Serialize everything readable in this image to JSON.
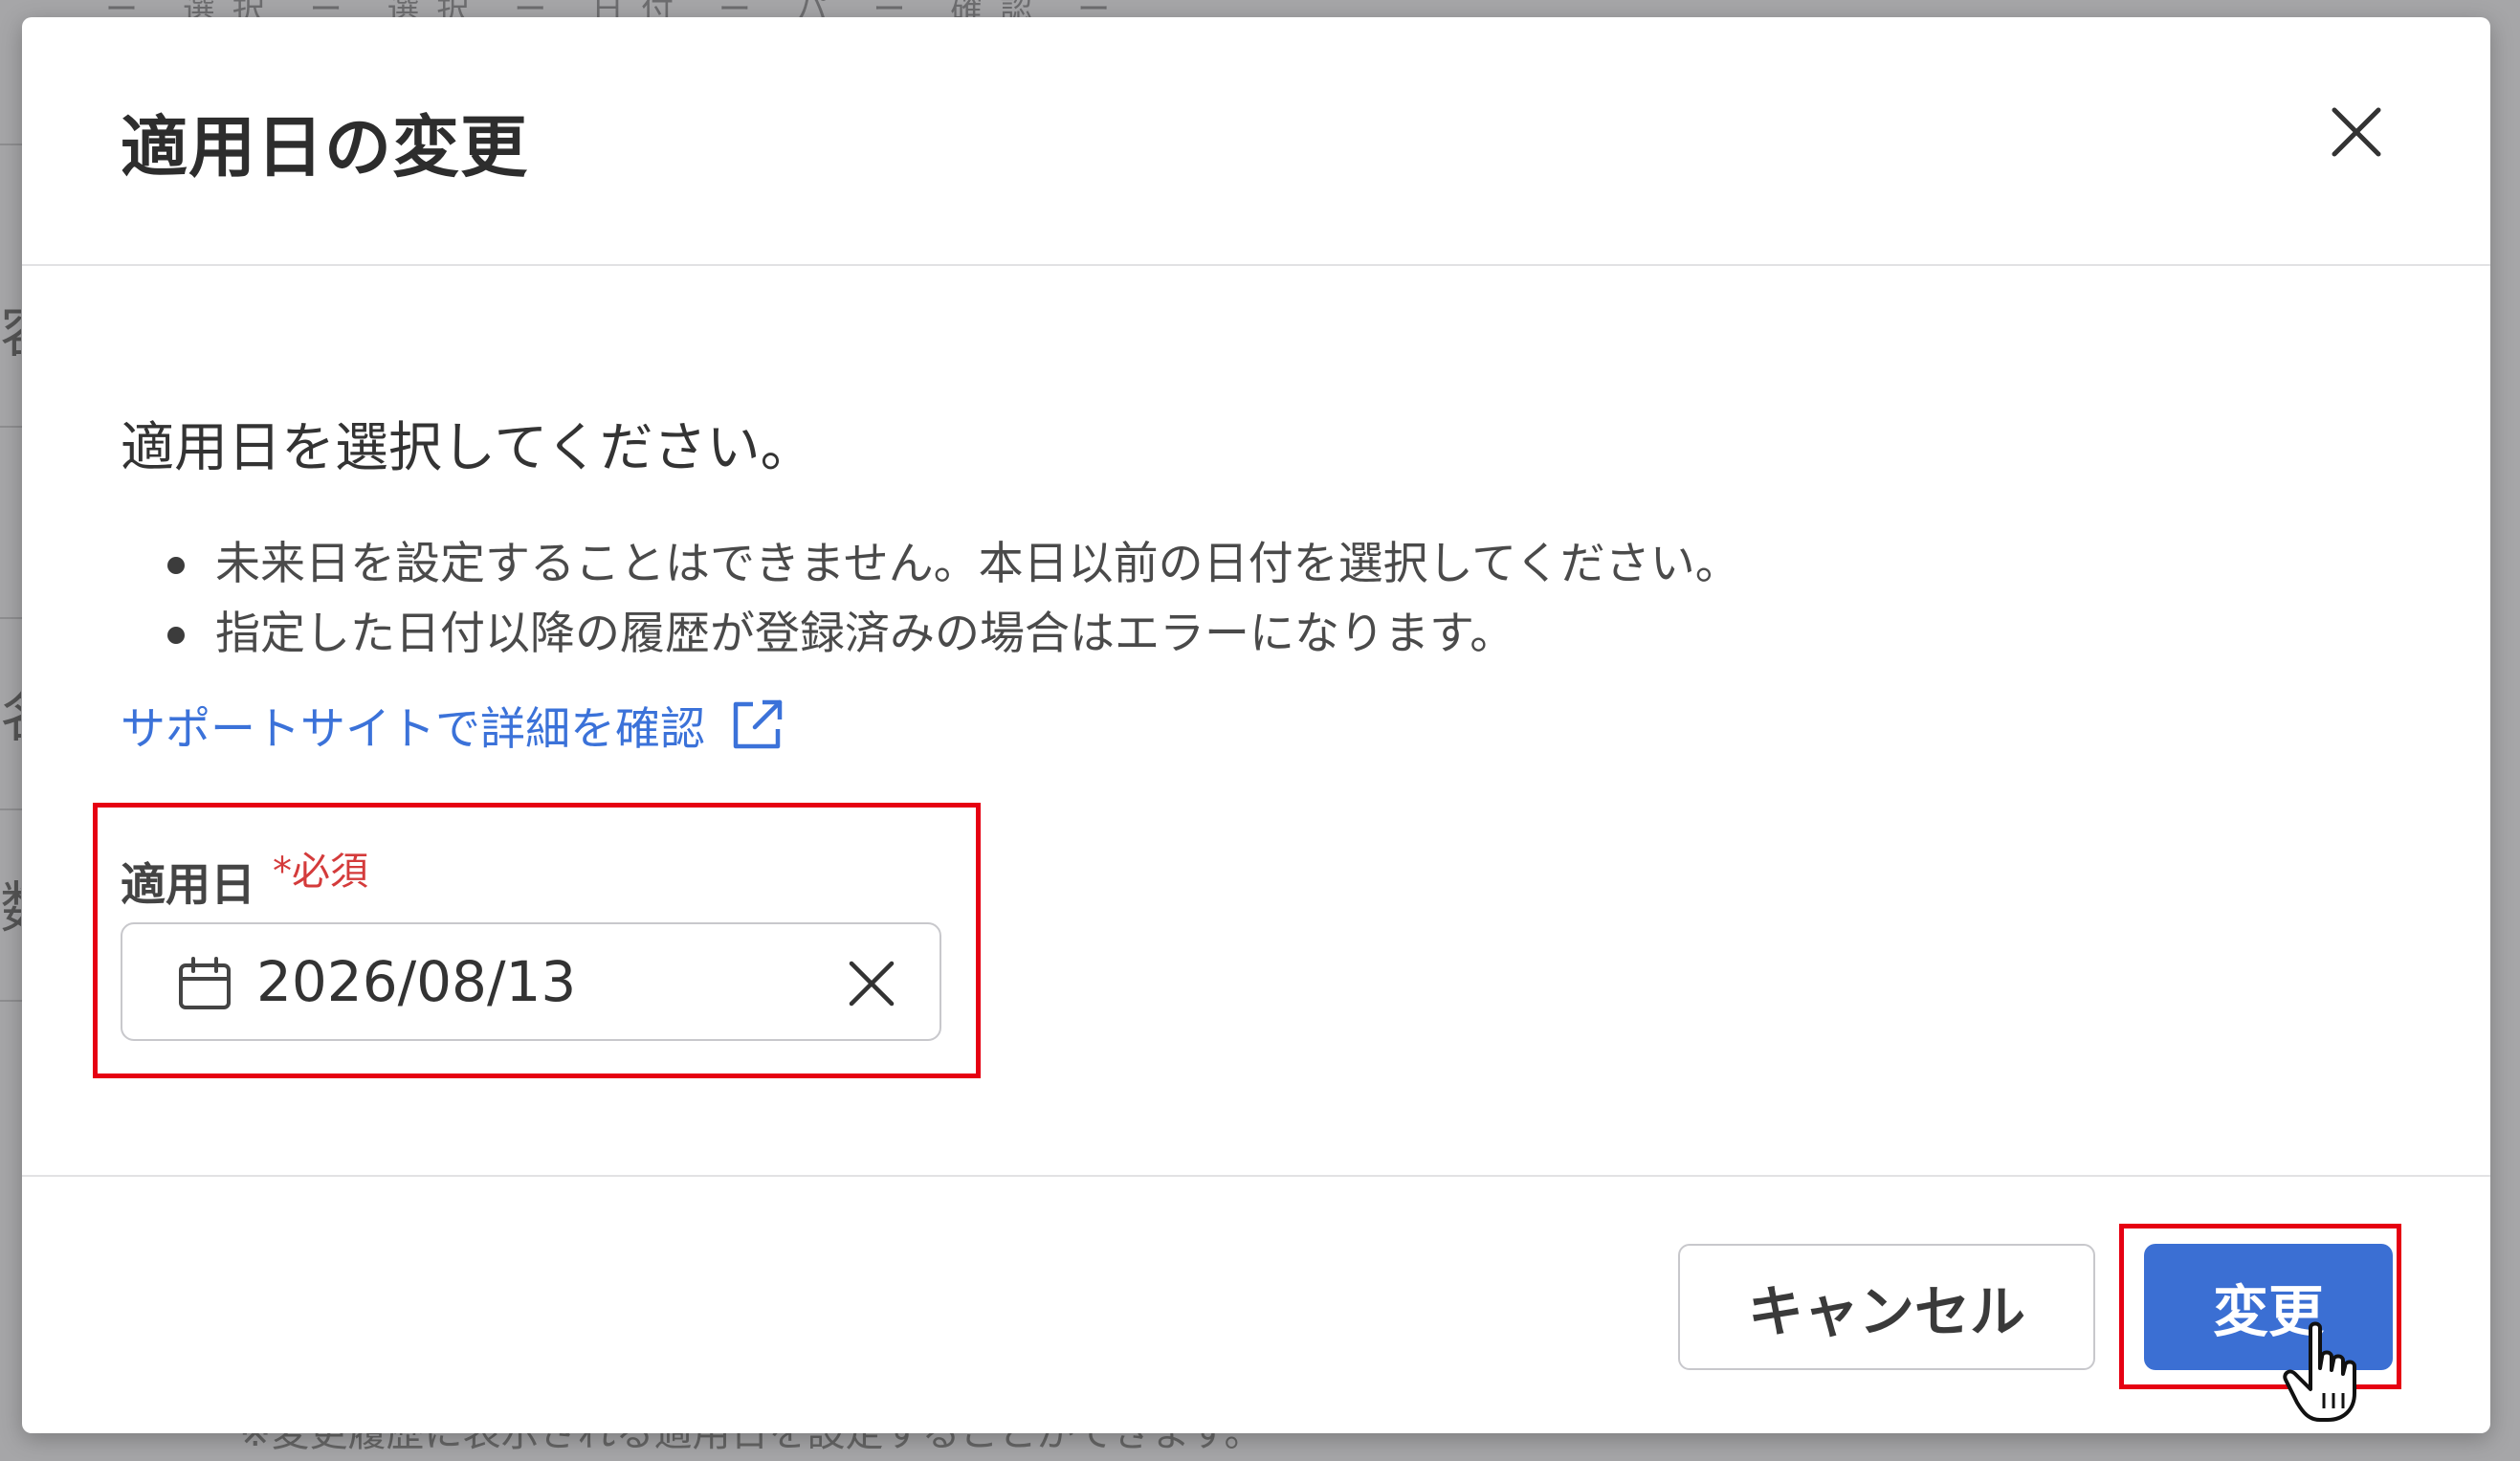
{
  "dialog": {
    "title": "適用日の変更",
    "prompt": "適用日を選択してください。",
    "notes": [
      "未来日を設定することはできません。本日以前の日付を選択してください。",
      "指定した日付以降の履歴が登録済みの場合はエラーになります。"
    ],
    "support_link": "サポートサイトで詳細を確認",
    "field": {
      "label": "適用日",
      "required": "*必須",
      "value": "2026/08/13"
    },
    "buttons": {
      "cancel": "キャンセル",
      "submit": "変更"
    }
  },
  "background": {
    "left_glyphs": [
      "容",
      "名",
      "数"
    ],
    "top_text": "ー 選択 ー 選択 ー 日付 ー パ ー 確認 ー",
    "bottom_text": "※変更履歴に表示される適用日を設定することができます。"
  },
  "colors": {
    "accent": "#3b6fd3",
    "link": "#3b72d9",
    "required": "#d43b3b",
    "highlight": "#e60012"
  },
  "icons": [
    "close-icon",
    "external-link-icon",
    "calendar-icon",
    "clear-icon",
    "hand-cursor-icon"
  ]
}
